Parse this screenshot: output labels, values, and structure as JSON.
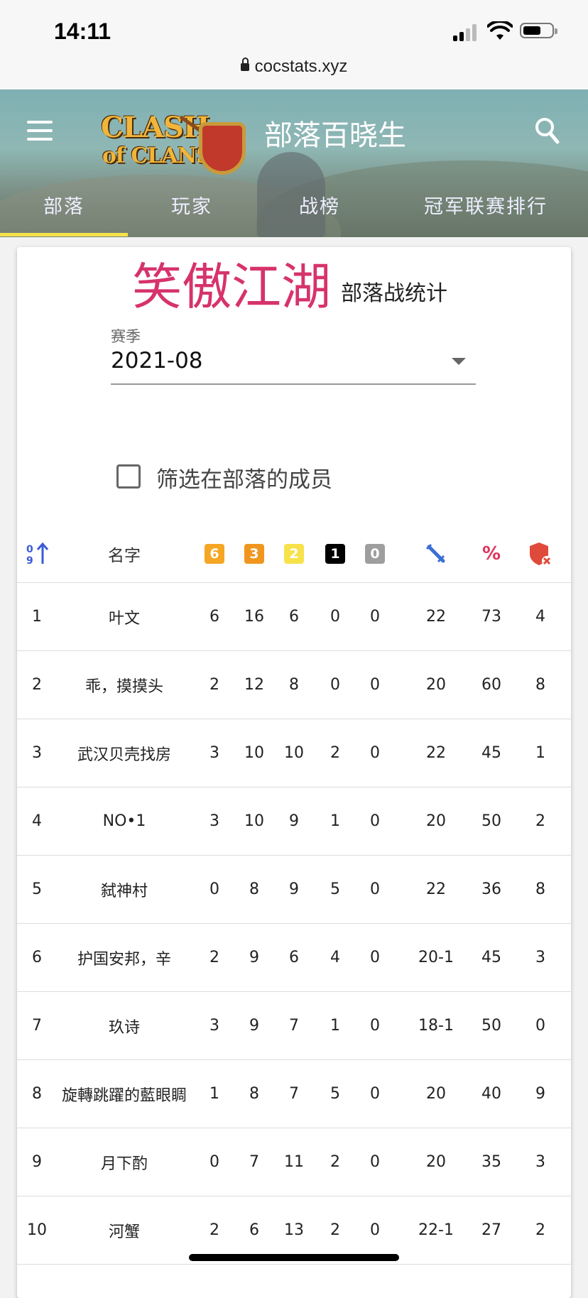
{
  "status": {
    "time": "14:11"
  },
  "browser": {
    "url": "cocstats.xyz"
  },
  "header": {
    "logo_line1": "CLASH",
    "logo_line2": "of CLANS",
    "site_title": "部落百晓生",
    "tabs": [
      "部落",
      "玩家",
      "战榜",
      "冠军联赛排行"
    ],
    "active_tab": "部落"
  },
  "clan": {
    "name": "笑傲江湖",
    "subtitle": "部落战统计"
  },
  "season": {
    "label": "赛季",
    "value": "2021-08"
  },
  "filter": {
    "label": "筛选在部落的成员",
    "checked": false
  },
  "table": {
    "name_header": "名字",
    "star_badges": [
      {
        "label": "6",
        "color": "#f5a623"
      },
      {
        "label": "3",
        "color": "#f0961e"
      },
      {
        "label": "2",
        "color": "#f7e24b"
      },
      {
        "label": "1",
        "color": "#000000"
      },
      {
        "label": "0",
        "color": "#9e9e9e"
      }
    ],
    "icons": {
      "sort": "sort-numeric-icon",
      "attacks": "sword-icon",
      "percent": "percent-icon",
      "defense": "shield-x-icon"
    },
    "rows": [
      {
        "rank": "1",
        "name": "叶文",
        "s6": "6",
        "s3": "16",
        "s2": "6",
        "s1": "0",
        "s0": "0",
        "attacks": "22",
        "pct": "73",
        "def": "4"
      },
      {
        "rank": "2",
        "name": "乖，摸摸头",
        "s6": "2",
        "s3": "12",
        "s2": "8",
        "s1": "0",
        "s0": "0",
        "attacks": "20",
        "pct": "60",
        "def": "8"
      },
      {
        "rank": "3",
        "name": "武汉贝壳找房",
        "s6": "3",
        "s3": "10",
        "s2": "10",
        "s1": "2",
        "s0": "0",
        "attacks": "22",
        "pct": "45",
        "def": "1"
      },
      {
        "rank": "4",
        "name": "NO•1",
        "s6": "3",
        "s3": "10",
        "s2": "9",
        "s1": "1",
        "s0": "0",
        "attacks": "20",
        "pct": "50",
        "def": "2"
      },
      {
        "rank": "5",
        "name": "弑神村",
        "s6": "0",
        "s3": "8",
        "s2": "9",
        "s1": "5",
        "s0": "0",
        "attacks": "22",
        "pct": "36",
        "def": "8"
      },
      {
        "rank": "6",
        "name": "护国安邦，辛",
        "s6": "2",
        "s3": "9",
        "s2": "6",
        "s1": "4",
        "s0": "0",
        "attacks": "20-1",
        "pct": "45",
        "def": "3"
      },
      {
        "rank": "7",
        "name": "玖诗",
        "s6": "3",
        "s3": "9",
        "s2": "7",
        "s1": "1",
        "s0": "0",
        "attacks": "18-1",
        "pct": "50",
        "def": "0"
      },
      {
        "rank": "8",
        "name": "旋轉跳躍的藍眼睭",
        "s6": "1",
        "s3": "8",
        "s2": "7",
        "s1": "5",
        "s0": "0",
        "attacks": "20",
        "pct": "40",
        "def": "9"
      },
      {
        "rank": "9",
        "name": "月下酌",
        "s6": "0",
        "s3": "7",
        "s2": "11",
        "s1": "2",
        "s0": "0",
        "attacks": "20",
        "pct": "35",
        "def": "3"
      },
      {
        "rank": "10",
        "name": "河蟹",
        "s6": "2",
        "s3": "6",
        "s2": "13",
        "s1": "2",
        "s0": "0",
        "attacks": "22-1",
        "pct": "27",
        "def": "2"
      }
    ]
  },
  "colors": {
    "accent_pink": "#d6336c",
    "tab_indicator": "#f3e24c",
    "sword_blue": "#3b6fd6",
    "shield_red": "#e04a3a"
  }
}
